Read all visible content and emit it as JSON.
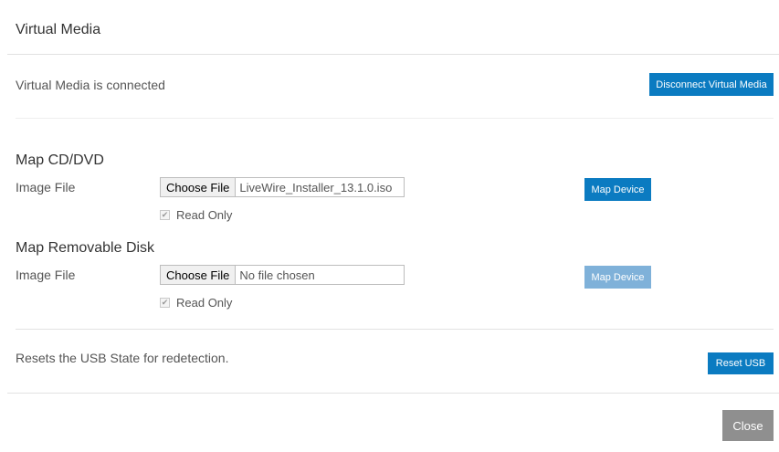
{
  "dialog": {
    "title": "Virtual Media",
    "status_text": "Virtual Media is connected",
    "disconnect_label": "Disconnect Virtual Media"
  },
  "map_cd": {
    "heading": "Map CD/DVD",
    "image_file_label": "Image File",
    "choose_file_label": "Choose File",
    "file_name": "LiveWire_Installer_13.1.0.iso",
    "read_only_label": "Read Only",
    "read_only_checked": true,
    "map_label": "Map Device"
  },
  "map_disk": {
    "heading": "Map Removable Disk",
    "image_file_label": "Image File",
    "choose_file_label": "Choose File",
    "file_name": "No file chosen",
    "read_only_label": "Read Only",
    "read_only_checked": true,
    "map_label": "Map Device"
  },
  "usb": {
    "description": "Resets the USB State for redetection.",
    "reset_label": "Reset USB"
  },
  "footer": {
    "close_label": "Close"
  },
  "colors": {
    "primary_button": "#0b7bc1",
    "disabled_button": "#7fb1d9",
    "close_button": "#8f8f8f"
  },
  "icons": {
    "checkbox_checked": "checkmark-icon"
  }
}
